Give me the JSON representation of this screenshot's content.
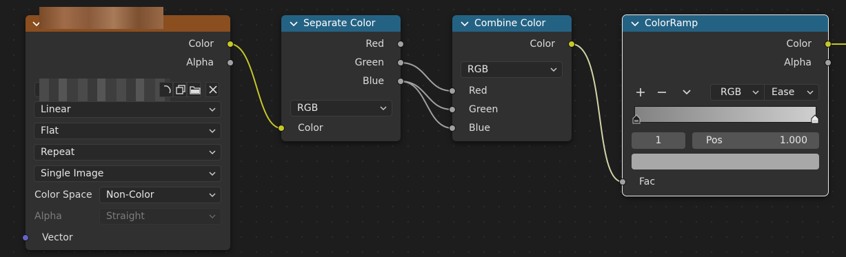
{
  "wire_colors": {
    "yellow": "#c7c729",
    "gray": "#a1a1a1",
    "light": "#d4d4a8",
    "purple": "#6363c7",
    "node_header_converter": "#246283",
    "node_header_texture": "#8a4e1f"
  },
  "image_texture": {
    "outputs": [
      "Color",
      "Alpha"
    ],
    "interpolation": "Linear",
    "projection": "Flat",
    "extension": "Repeat",
    "source": "Single Image",
    "color_space_label": "Color Space",
    "color_space_value": "Non-Color",
    "alpha_label": "Alpha",
    "alpha_value": "Straight",
    "vector_input": "Vector",
    "toolbar_icons": [
      "shield-icon",
      "duplicate-icon",
      "folder-icon",
      "close-icon"
    ]
  },
  "separate_color": {
    "title": "Separate Color",
    "outputs": [
      "Red",
      "Green",
      "Blue"
    ],
    "mode": "RGB",
    "input": "Color"
  },
  "combine_color": {
    "title": "Combine Color",
    "output": "Color",
    "mode": "RGB",
    "inputs": [
      "Red",
      "Green",
      "Blue"
    ]
  },
  "color_ramp": {
    "title": "ColorRamp",
    "outputs": [
      "Color",
      "Alpha"
    ],
    "color_mode": "RGB",
    "interpolation": "Ease",
    "active_index": "1",
    "pos_label": "Pos",
    "pos_value": "1.000",
    "input": "Fac",
    "ramp_start_color": "#828282",
    "ramp_end_color": "#cfcfcf",
    "swatch_color": "#a8a8a8",
    "icons": [
      "plus-icon",
      "minus-icon",
      "chevron-down-icon"
    ]
  }
}
